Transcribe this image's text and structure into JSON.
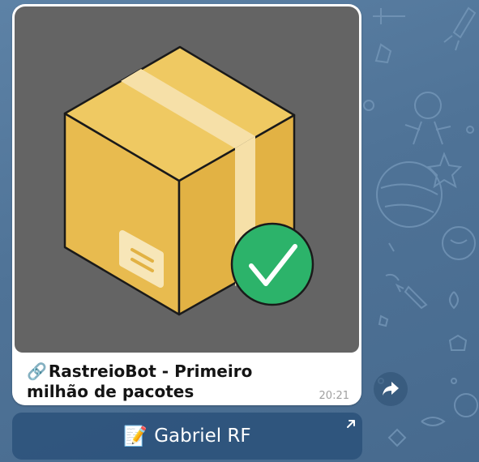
{
  "message": {
    "caption_emoji": "🔗",
    "caption": "RastreioBot - Primeiro milhão de pacotes",
    "time": "20:21",
    "preview_icon": "package-box-with-checkmark"
  },
  "share_button": {
    "icon": "share-arrow-icon"
  },
  "inline_button": {
    "emoji": "📝",
    "label": "Gabriel RF",
    "corner_icon": "external-link-arrow-icon"
  },
  "colors": {
    "chat_background": "#4f7397",
    "preview_background": "#646464",
    "box_front": "#e8bb4f",
    "box_top": "#efc962",
    "tape": "#f6e0a8",
    "check_green": "#2cb36a",
    "button_background": "#2e5680"
  }
}
